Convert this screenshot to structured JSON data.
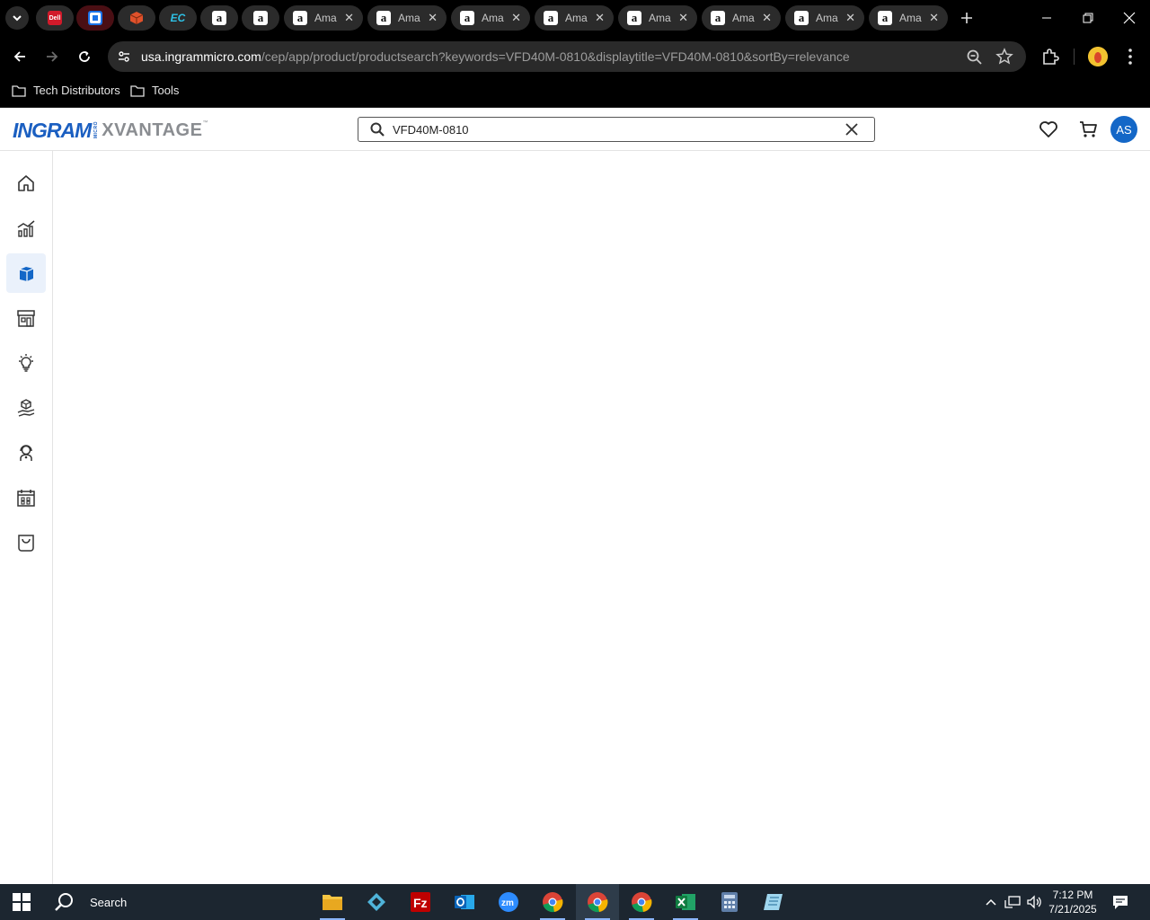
{
  "browser": {
    "tabs": [
      {
        "kind": "pinned",
        "icon": "dell-icon"
      },
      {
        "kind": "pinned",
        "icon": "google-sheets-icon",
        "active": true
      },
      {
        "kind": "pinned",
        "icon": "package-icon"
      },
      {
        "kind": "pinned",
        "icon": "ec-icon",
        "text": "EC"
      },
      {
        "kind": "pinned",
        "icon": "amazon-icon",
        "text": "a"
      },
      {
        "kind": "pinned",
        "icon": "amazon-icon",
        "text": "a"
      },
      {
        "kind": "tab",
        "icon": "amazon-icon",
        "text": "a",
        "title": "Ama"
      },
      {
        "kind": "tab",
        "icon": "amazon-icon",
        "text": "a",
        "title": "Ama"
      },
      {
        "kind": "tab",
        "icon": "amazon-icon",
        "text": "a",
        "title": "Ama"
      },
      {
        "kind": "tab",
        "icon": "amazon-icon",
        "text": "a",
        "title": "Ama"
      },
      {
        "kind": "tab",
        "icon": "amazon-icon",
        "text": "a",
        "title": "Ama"
      },
      {
        "kind": "tab",
        "icon": "amazon-icon",
        "text": "a",
        "title": "Ama"
      },
      {
        "kind": "tab",
        "icon": "amazon-icon",
        "text": "a",
        "title": "Ama"
      },
      {
        "kind": "tab",
        "icon": "amazon-icon",
        "text": "a",
        "title": "Ama"
      }
    ],
    "url_host": "usa.ingrammicro.com",
    "url_path": "/cep/app/product/productsearch?keywords=VFD40M-0810&displaytitle=VFD40M-0810&sortBy=relevance",
    "bookmarks": [
      {
        "label": "Tech Distributors"
      },
      {
        "label": "Tools"
      }
    ]
  },
  "header": {
    "logo_primary": "INGRAM",
    "logo_micro": "MICRO",
    "logo_secondary": "XVANTAGE",
    "logo_tm": "™",
    "search_value": "VFD40M-0810",
    "avatar_initials": "AS"
  },
  "sidebar": {
    "items": [
      {
        "name": "home",
        "icon": "home-icon"
      },
      {
        "name": "analytics",
        "icon": "chart-icon"
      },
      {
        "name": "products",
        "icon": "box-icon",
        "active": true
      },
      {
        "name": "store",
        "icon": "storefront-icon"
      },
      {
        "name": "ideas",
        "icon": "lightbulb-icon"
      },
      {
        "name": "hand-cube",
        "icon": "hand-cube-icon"
      },
      {
        "name": "support",
        "icon": "support-person-icon"
      },
      {
        "name": "calendar",
        "icon": "calendar-icon"
      },
      {
        "name": "orders",
        "icon": "shopping-bag-icon"
      }
    ]
  },
  "taskbar": {
    "search_label": "Search",
    "time": "7:12 PM",
    "date": "7/21/2025"
  },
  "colors": {
    "brand_blue": "#1b5fc1",
    "avatar_blue": "#1467c7",
    "active_tab": "#4a0f14",
    "taskbar": "#1c2630"
  }
}
